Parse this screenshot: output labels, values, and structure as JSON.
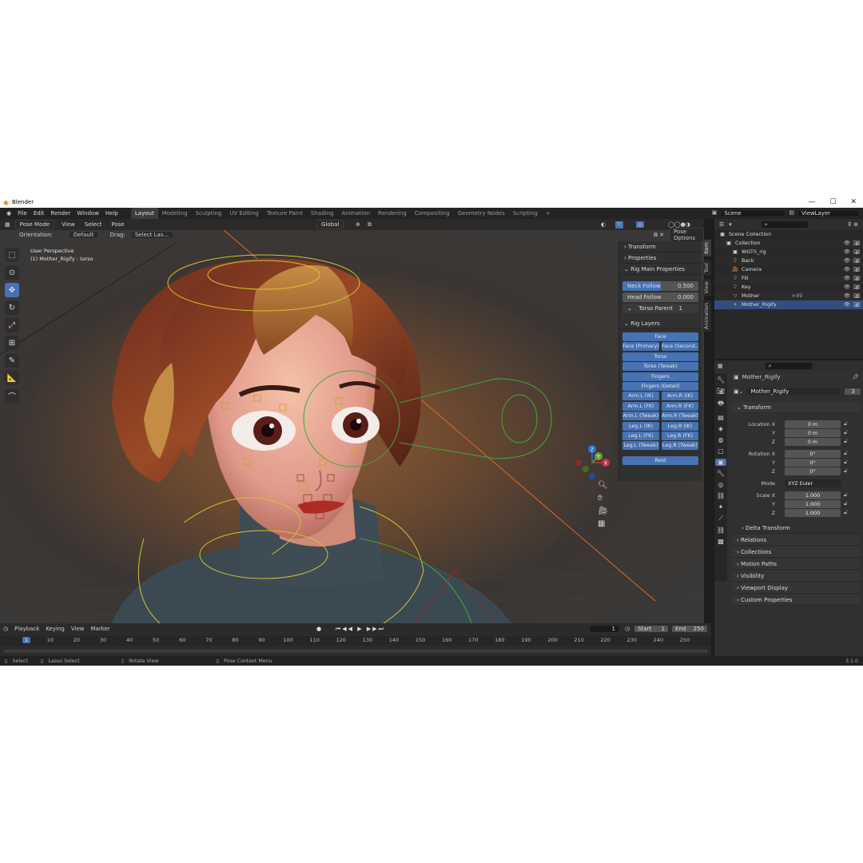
{
  "window": {
    "title": "Blender",
    "controls": [
      "—",
      "☐",
      "✕"
    ]
  },
  "menubar": {
    "menus": [
      "File",
      "Edit",
      "Render",
      "Window",
      "Help"
    ],
    "workspaces": [
      "Layout",
      "Modeling",
      "Sculpting",
      "UV Editing",
      "Texture Paint",
      "Shading",
      "Animation",
      "Rendering",
      "Compositing",
      "Geometry Nodes",
      "Scripting",
      "+"
    ],
    "active_workspace": "Layout",
    "scene": "Scene",
    "view_layer": "ViewLayer"
  },
  "viewport": {
    "mode": "Pose Mode",
    "menus": [
      "View",
      "Select",
      "Pose"
    ],
    "orientation_label": "Orientation:",
    "orientation": "Default",
    "drag_label": "Drag:",
    "drag": "Select Las...",
    "transform_orientation": "Global",
    "pose_options": "Pose Options",
    "perspective": "User Perspective",
    "active_object": "(1) Mother_Rigify : torso",
    "gizmo_axes": [
      "X",
      "Y",
      "Z"
    ]
  },
  "npanel": {
    "sections": {
      "transform": "Transform",
      "properties": "Properties",
      "rig_main": "Rig Main Properties",
      "rig_layers": "Rig Layers"
    },
    "neck_follow": {
      "label": "Neck Follow",
      "value": "0.500",
      "fraction": 0.5
    },
    "head_follow": {
      "label": "Head Follow",
      "value": "0.000",
      "fraction": 0.0
    },
    "torso_parent": {
      "label": "Torso Parent",
      "value": "1"
    },
    "layers": [
      [
        "Face"
      ],
      [
        "Face (Primary)",
        "Face (Second..."
      ],
      [
        "Torso"
      ],
      [
        "Torso (Tweak)"
      ],
      [
        "Fingers"
      ],
      [
        "Fingers (Detail)"
      ],
      [
        "Arm.L (IK)",
        "Arm.R (IK)"
      ],
      [
        "Arm.L (FK)",
        "Arm.R (FK)"
      ],
      [
        "Arm.L (Tweak)",
        "Arm.R (Tweak)"
      ],
      [
        "Leg.L (IK)",
        "Leg.R (IK)"
      ],
      [
        "Leg.L (FK)",
        "Leg.R (FK)"
      ],
      [
        "Leg.L (Tweak)",
        "Leg.R (Tweak)"
      ]
    ],
    "root": "Root",
    "tabs": [
      "Item",
      "Tool",
      "View",
      "Animation"
    ]
  },
  "timeline": {
    "menus": [
      "Playback",
      "Keying",
      "View",
      "Marker"
    ],
    "current_frame": "1",
    "start_label": "Start",
    "start": "1",
    "end_label": "End",
    "end": "250",
    "ticks": [
      "1",
      "10",
      "20",
      "30",
      "40",
      "50",
      "60",
      "70",
      "80",
      "90",
      "100",
      "110",
      "120",
      "130",
      "140",
      "150",
      "160",
      "170",
      "180",
      "190",
      "200",
      "210",
      "220",
      "230",
      "240",
      "250"
    ]
  },
  "statusbar": {
    "select": "Select",
    "lasso": "Lasso Select",
    "rotate": "Rotate View",
    "context": "Pose Context Menu",
    "version": "3.1.0"
  },
  "outliner": {
    "items": [
      {
        "label": "Scene Collection",
        "indent": 0,
        "icon": "collection-icon"
      },
      {
        "label": "Collection",
        "indent": 1,
        "icon": "collection-icon"
      },
      {
        "label": "WGTS_rig",
        "indent": 2,
        "icon": "collection-icon"
      },
      {
        "label": "Back",
        "indent": 2,
        "icon": "light-icon"
      },
      {
        "label": "Camera",
        "indent": 2,
        "icon": "camera-icon"
      },
      {
        "label": "Fill",
        "indent": 2,
        "icon": "light-icon"
      },
      {
        "label": "Key",
        "indent": 2,
        "icon": "light-icon"
      },
      {
        "label": "Mother",
        "indent": 2,
        "icon": "mesh-icon"
      },
      {
        "label": "Mother_Rigify",
        "indent": 2,
        "icon": "armature-icon"
      }
    ],
    "mother_badge": "×49"
  },
  "properties": {
    "object_name": "Mother_Rigify",
    "data_name": "Mother_Rigify",
    "users": "3",
    "transform": "Transform",
    "location": [
      {
        "k": "Location X",
        "v": "0 m"
      },
      {
        "k": "Y",
        "v": "0 m"
      },
      {
        "k": "Z",
        "v": "0 m"
      }
    ],
    "rotation": [
      {
        "k": "Rotation X",
        "v": "0°"
      },
      {
        "k": "Y",
        "v": "0°"
      },
      {
        "k": "Z",
        "v": "0°"
      }
    ],
    "mode_label": "Mode",
    "mode": "XYZ Euler",
    "scale": [
      {
        "k": "Scale X",
        "v": "1.000"
      },
      {
        "k": "Y",
        "v": "1.000"
      },
      {
        "k": "Z",
        "v": "1.000"
      }
    ],
    "sections": [
      "Delta Transform",
      "Relations",
      "Collections",
      "Motion Paths",
      "Visibility",
      "Viewport Display",
      "Custom Properties"
    ]
  },
  "colors": {
    "accent": "#4772b3",
    "selected_row": "#334d80",
    "rig_green": "#3fa83f",
    "rig_yellow": "#d6c232"
  }
}
